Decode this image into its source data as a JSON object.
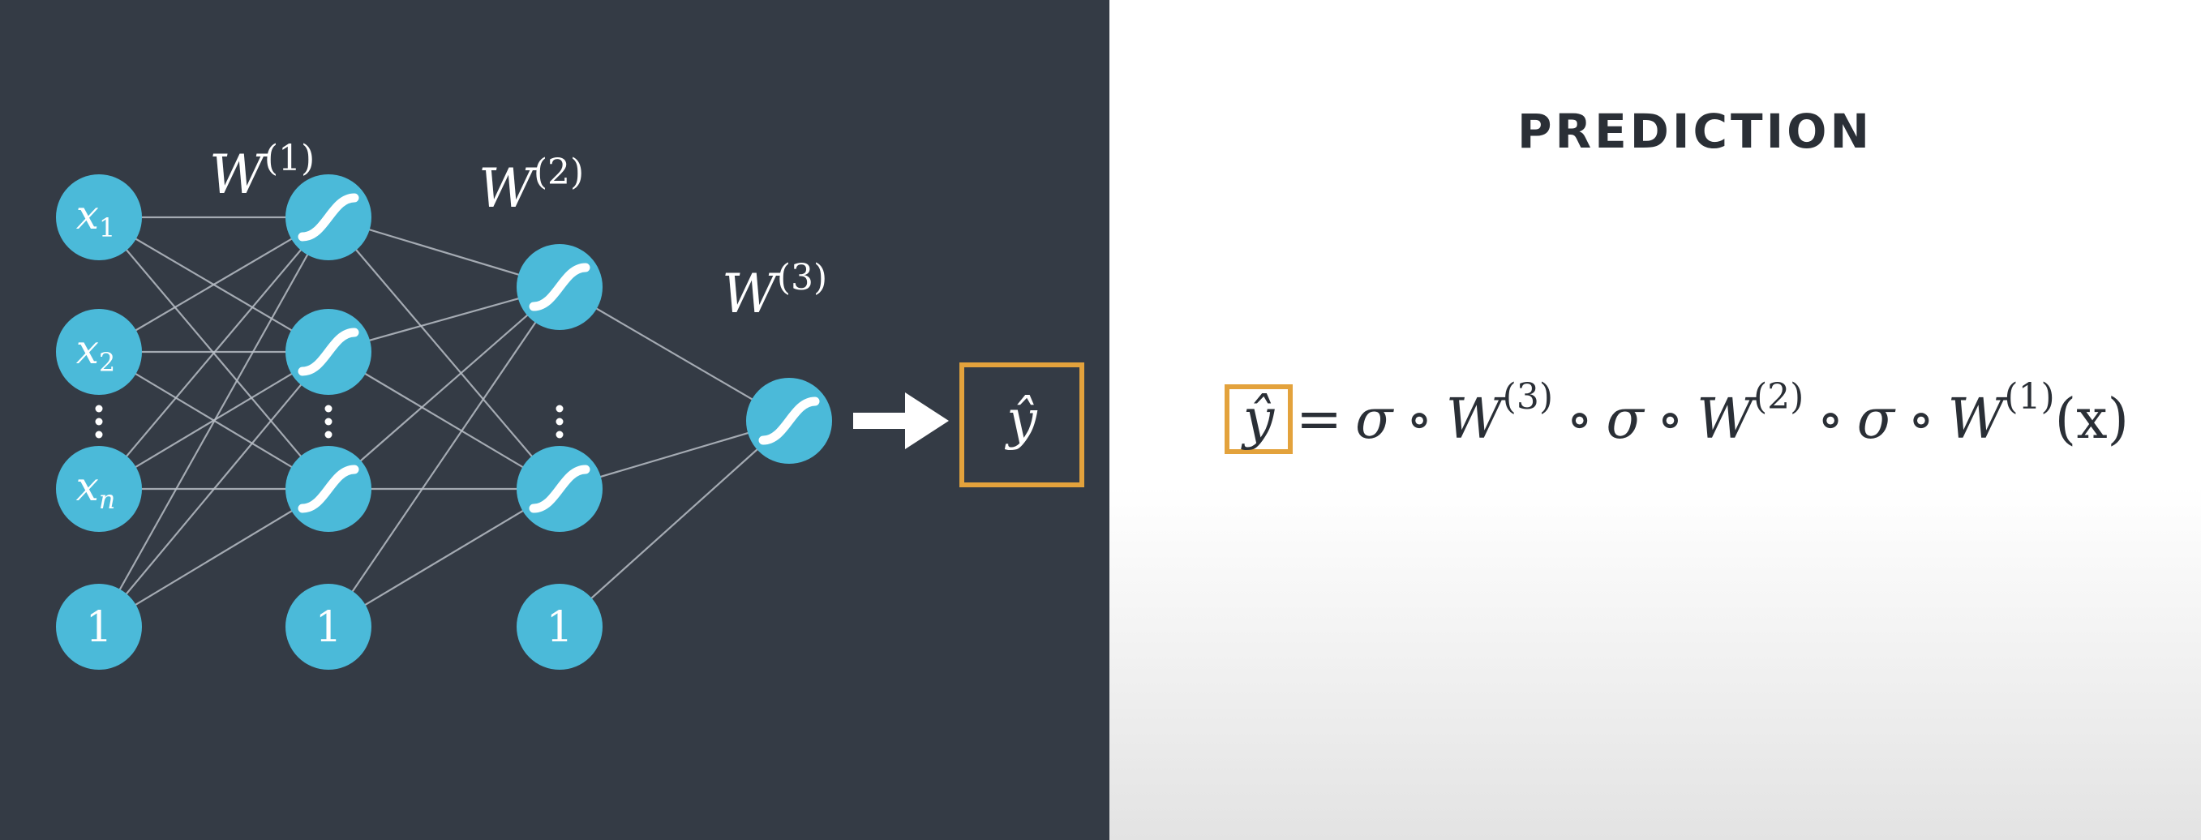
{
  "slide": {
    "title": "PREDICTION"
  },
  "network": {
    "input_labels": [
      "x",
      "x",
      "x"
    ],
    "input_subscripts": [
      "1",
      "2",
      "n"
    ],
    "bias_label": "1",
    "weight_labels": [
      {
        "base": "W",
        "sup": "(1)"
      },
      {
        "base": "W",
        "sup": "(2)"
      },
      {
        "base": "W",
        "sup": "(3)"
      }
    ],
    "output_label": "ŷ",
    "node_color": "#4bbad9",
    "edge_color": "#b8bec6",
    "box_color": "#e3a23c",
    "background_left": "#343b45"
  },
  "formula": {
    "yhat": "ŷ",
    "eq": "=",
    "sigma": "σ",
    "compose": "∘",
    "W": "W",
    "sup3": "(3)",
    "sup2": "(2)",
    "sup1": "(1)",
    "arg": "(x)"
  },
  "icons": {
    "sigmoid": "sigmoid-icon",
    "arrow": "arrow-right-icon",
    "ellipsis": "vertical-ellipsis-icon"
  }
}
